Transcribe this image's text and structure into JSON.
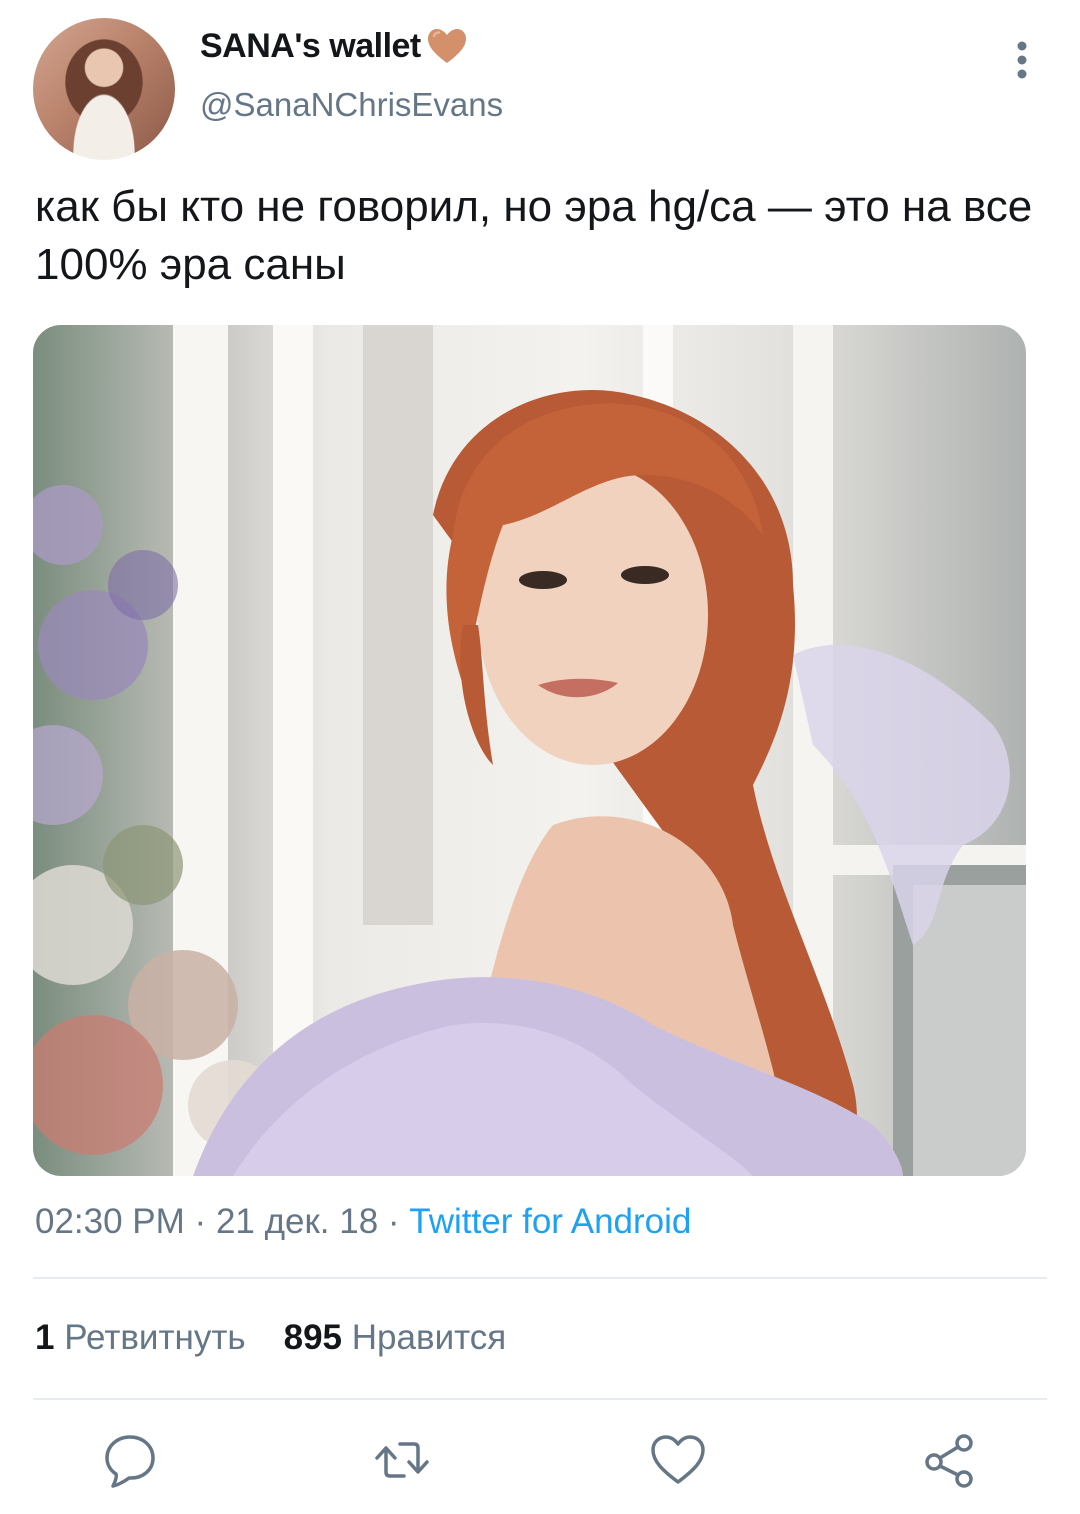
{
  "user": {
    "display_name": "SANA's wallet",
    "handle": "@SanaNChrisEvans",
    "avatar_icon": "profile-photo",
    "badge_icon": "brown-heart-emoji",
    "badge_color": "#d4906a"
  },
  "tweet": {
    "text": "как бы кто не говорил, но эра hg/ca — это на все 100% эра саны",
    "time": "02:30 PM",
    "date": "21 дек. 18",
    "separator": "·",
    "source": "Twitter for Android"
  },
  "stats": {
    "retweets_count": "1",
    "retweets_label": "Ретвитнуть",
    "likes_count": "895",
    "likes_label": "Нравится"
  },
  "actions": [
    {
      "name": "reply",
      "icon": "comment-bubble-icon"
    },
    {
      "name": "retweet",
      "icon": "retweet-arrows-icon"
    },
    {
      "name": "like",
      "icon": "heart-outline-icon"
    },
    {
      "name": "share",
      "icon": "share-nodes-icon"
    }
  ],
  "colors": {
    "text_primary": "#14171a",
    "text_secondary": "#657786",
    "link": "#1da1f2",
    "divider": "#e6ecf0"
  }
}
